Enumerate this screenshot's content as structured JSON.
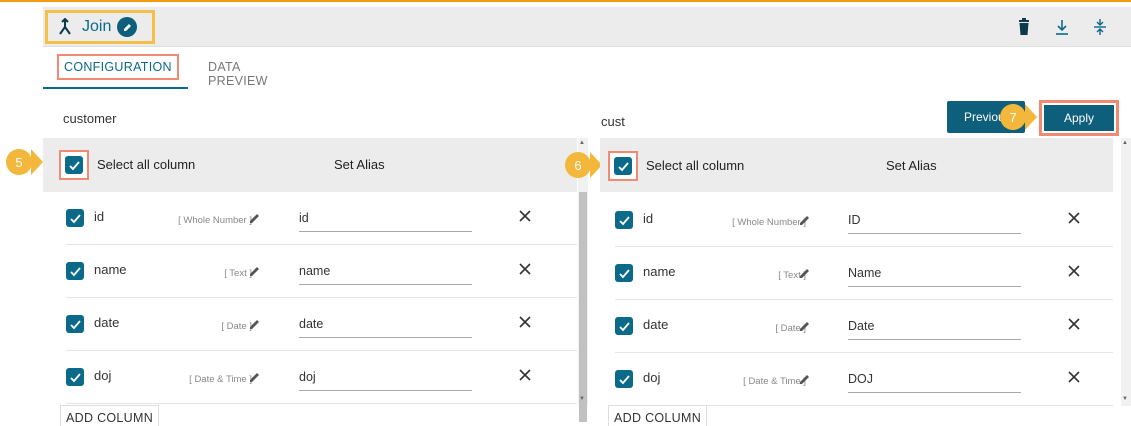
{
  "header": {
    "title": "Join",
    "icons": [
      "join-icon",
      "edit-icon",
      "trash-icon",
      "download-icon",
      "collapse-icon"
    ]
  },
  "tabs": [
    {
      "label": "CONFIGURATION",
      "active": true
    },
    {
      "label": "DATA PREVIEW",
      "active": false
    }
  ],
  "left": {
    "table_name": "customer",
    "select_all_label": "Select all column",
    "alias_header": "Set Alias",
    "badge": "5",
    "add_column_label": "ADD COLUMN",
    "rows": [
      {
        "name": "id",
        "type": "[ Whole Number ]",
        "alias": "id"
      },
      {
        "name": "name",
        "type": "[ Text ]",
        "alias": "name"
      },
      {
        "name": "date",
        "type": "[ Date ]",
        "alias": "date"
      },
      {
        "name": "doj",
        "type": "[ Date & Time ]",
        "alias": "doj"
      }
    ]
  },
  "right": {
    "table_name": "cust",
    "select_all_label": "Select all column",
    "alias_header": "Set Alias",
    "badge": "6",
    "add_column_label": "ADD COLUMN",
    "rows": [
      {
        "name": "id",
        "type": "[ Whole Number ]",
        "alias": "ID"
      },
      {
        "name": "name",
        "type": "[ Text ]",
        "alias": "Name"
      },
      {
        "name": "date",
        "type": "[ Date ]",
        "alias": "Date"
      },
      {
        "name": "doj",
        "type": "[ Date & Time ]",
        "alias": "DOJ"
      }
    ]
  },
  "buttons": {
    "previous_label": "Previou",
    "apply_label": "Apply",
    "apply_badge": "7"
  },
  "colors": {
    "accent": "#0d5f7c",
    "highlight": "#f08a73",
    "badge": "#f2b73b",
    "title_border": "#f5c04a"
  }
}
